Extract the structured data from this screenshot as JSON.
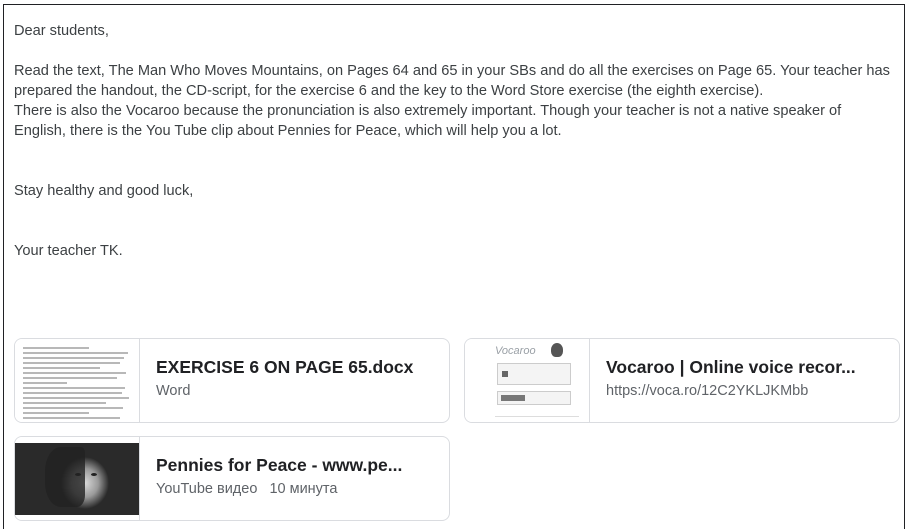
{
  "post": {
    "greeting": "Dear students,",
    "paragraph1": "Read the text, The Man Who Moves Mountains, on Pages 64 and 65 in your SBs and do all the exercises on Page 65. Your teacher has prepared the handout, the CD-script, for the exercise 6 and the key to the Word Store exercise (the eighth exercise).",
    "paragraph2": "There is also the Vocaroo because the pronunciation is also extremely important. Though your teacher is not a native speaker of English, there is the You Tube clip about Pennies for Peace, which will help you a lot.",
    "closing": "Stay healthy and good luck,",
    "signature": "Your teacher TK."
  },
  "attachments": [
    {
      "title": "EXERCISE 6 ON PAGE 65.docx",
      "subtitle": "Word",
      "icon": "docx-thumbnail"
    },
    {
      "title": "Vocaroo | Online voice recor...",
      "subtitle": "https://voca.ro/12C2YKLJKMbb",
      "icon": "vocaroo-thumbnail"
    },
    {
      "title": "Pennies for Peace - www.pe...",
      "subtitle": "YouTube видео",
      "duration": "10 минута",
      "icon": "youtube-thumbnail"
    }
  ]
}
